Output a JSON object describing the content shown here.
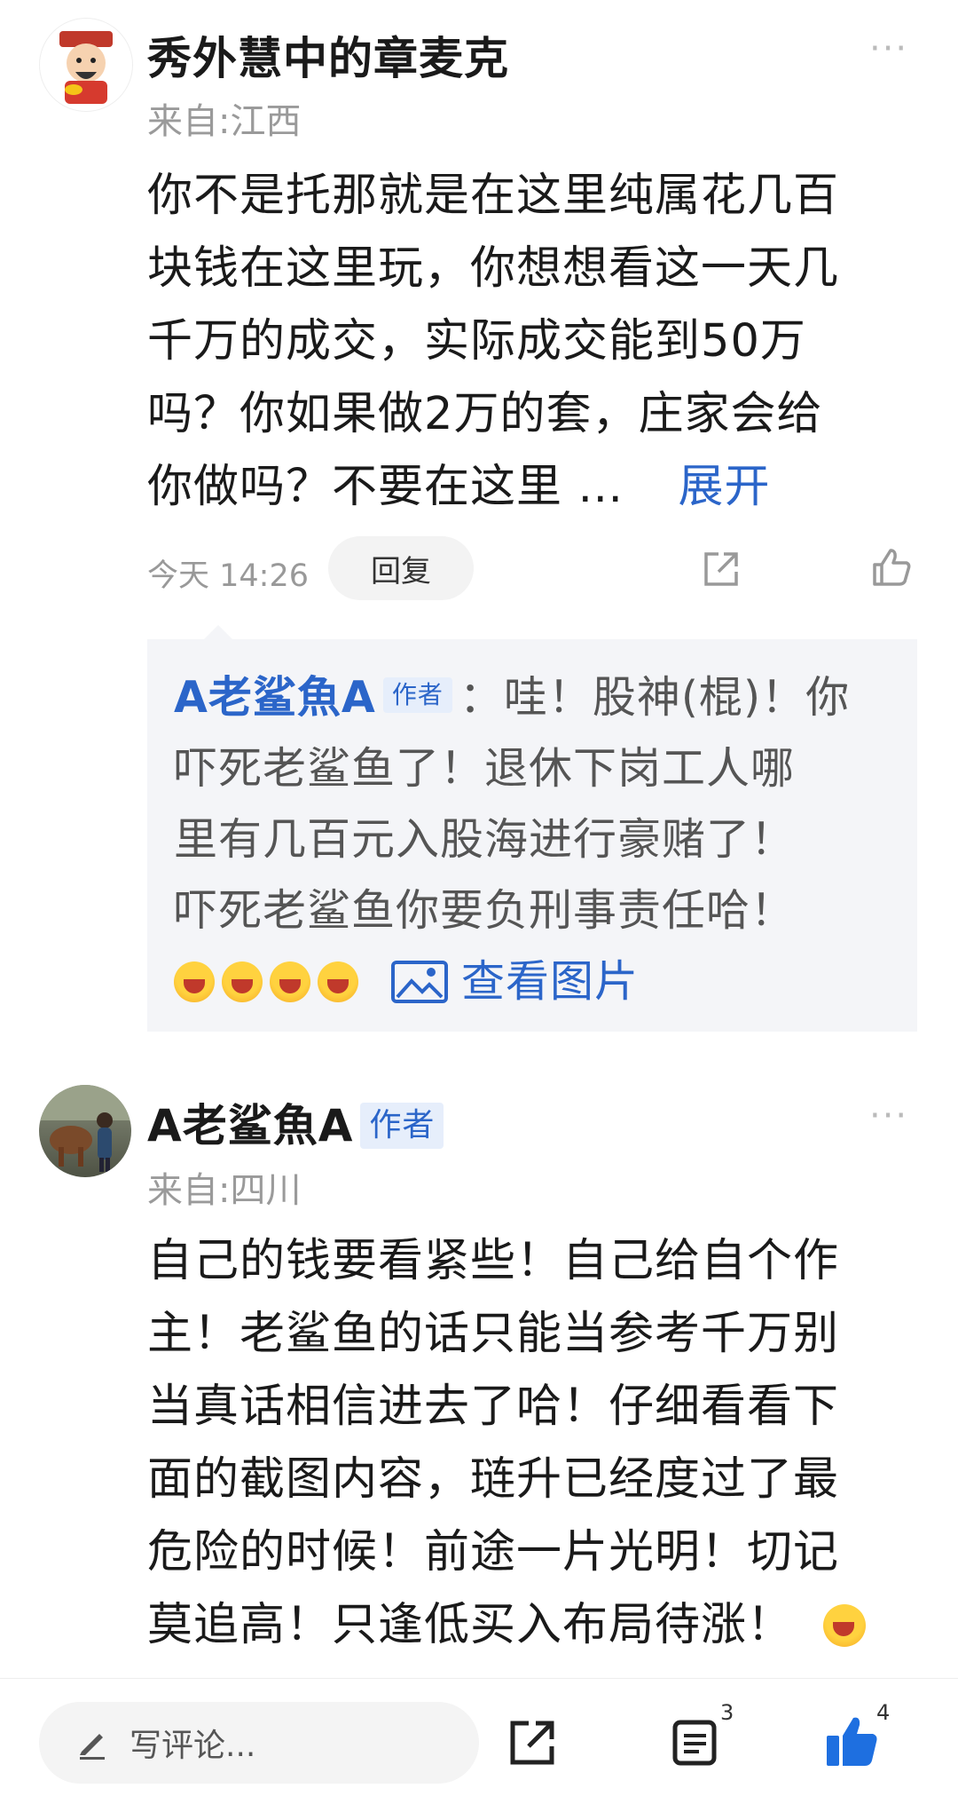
{
  "comment1": {
    "username": "秀外慧中的章麦克",
    "location": "来自:江西",
    "more": "···",
    "lines": [
      "你不是托那就是在这里纯属花几百",
      "块钱在这里玩，你想想看这一天几",
      "千万的成交，实际成交能到50万",
      "吗？你如果做2万的套，庄家会给"
    ],
    "last_line": "你做吗？不要在这里 …",
    "expand_label": "展开",
    "time": "今天 14:26",
    "reply_label": "回复"
  },
  "quote": {
    "author": "A老鲨魚A",
    "badge": "作者",
    "line1": "：哇！股神(棍)！你",
    "lines": [
      "吓死老鲨鱼了！退休下岗工人哪",
      "里有几百元入股海进行豪赌了！",
      "吓死老鲨鱼你要负刑事责任哈！"
    ],
    "view_image_label": "查看图片"
  },
  "comment2": {
    "username": "A老鲨魚A",
    "badge": "作者",
    "location": "来自:四川",
    "more": "···",
    "lines": [
      "自己的钱要看紧些！自己给自个作",
      "主！老鲨鱼的话只能当参考千万别",
      "当真话相信进去了哈！仔细看看下",
      "面的截图内容，琏升已经度过了最",
      "危险的时候！前途一片光明！切记",
      "莫追高！只逢低买入布局待涨！"
    ]
  },
  "bottom_bar": {
    "comment_placeholder": "写评论...",
    "comment_count": "3",
    "like_count": "4"
  },
  "colors": {
    "accent": "#2b65c9",
    "like_blue": "#1e6fe0"
  }
}
